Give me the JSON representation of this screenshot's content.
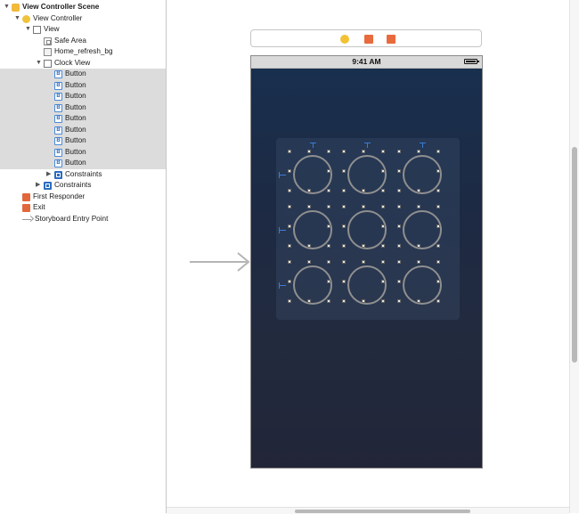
{
  "outline": {
    "items": [
      {
        "label": "View Controller Scene",
        "level": 0,
        "tri": "down",
        "icon": "scene",
        "selected": false
      },
      {
        "label": "View Controller",
        "level": 1,
        "tri": "down",
        "icon": "vc",
        "selected": false
      },
      {
        "label": "View",
        "level": 2,
        "tri": "down",
        "icon": "view",
        "selected": false
      },
      {
        "label": "Safe Area",
        "level": 3,
        "tri": "",
        "icon": "safe",
        "selected": false
      },
      {
        "label": "Home_refresh_bg",
        "level": 3,
        "tri": "",
        "icon": "img",
        "selected": false
      },
      {
        "label": "Clock View",
        "level": 3,
        "tri": "down",
        "icon": "view",
        "selected": false
      },
      {
        "label": "Button",
        "level": 4,
        "tri": "",
        "icon": "btn",
        "selected": true
      },
      {
        "label": "Button",
        "level": 4,
        "tri": "",
        "icon": "btn",
        "selected": true
      },
      {
        "label": "Button",
        "level": 4,
        "tri": "",
        "icon": "btn",
        "selected": true
      },
      {
        "label": "Button",
        "level": 4,
        "tri": "",
        "icon": "btn",
        "selected": true
      },
      {
        "label": "Button",
        "level": 4,
        "tri": "",
        "icon": "btn",
        "selected": true
      },
      {
        "label": "Button",
        "level": 4,
        "tri": "",
        "icon": "btn",
        "selected": true
      },
      {
        "label": "Button",
        "level": 4,
        "tri": "",
        "icon": "btn",
        "selected": true
      },
      {
        "label": "Button",
        "level": 4,
        "tri": "",
        "icon": "btn",
        "selected": true
      },
      {
        "label": "Button",
        "level": 4,
        "tri": "",
        "icon": "btn",
        "selected": true
      },
      {
        "label": "Constraints",
        "level": 4,
        "tri": "right",
        "icon": "cons",
        "selected": false
      },
      {
        "label": "Constraints",
        "level": 3,
        "tri": "right",
        "icon": "cons",
        "selected": false
      },
      {
        "label": "First Responder",
        "level": 1,
        "tri": "",
        "icon": "fr",
        "selected": false
      },
      {
        "label": "Exit",
        "level": 1,
        "tri": "",
        "icon": "exit",
        "selected": false
      },
      {
        "label": "Storyboard Entry Point",
        "level": 1,
        "tri": "",
        "icon": "entry",
        "selected": false
      }
    ]
  },
  "canvas": {
    "scene_dock_icons": [
      "view-controller-icon",
      "first-responder-icon",
      "exit-icon"
    ],
    "device": {
      "status_time": "9:41 AM",
      "background": "Home_refresh_bg",
      "clock_view": {
        "rows": 3,
        "cols": 3,
        "button_count": 9
      }
    }
  },
  "colors": {
    "selection": "#dcdcdc",
    "accent_blue": "#3a7cd6",
    "scene_icon": "#f2c234",
    "responder_icon": "#e96a3d"
  }
}
